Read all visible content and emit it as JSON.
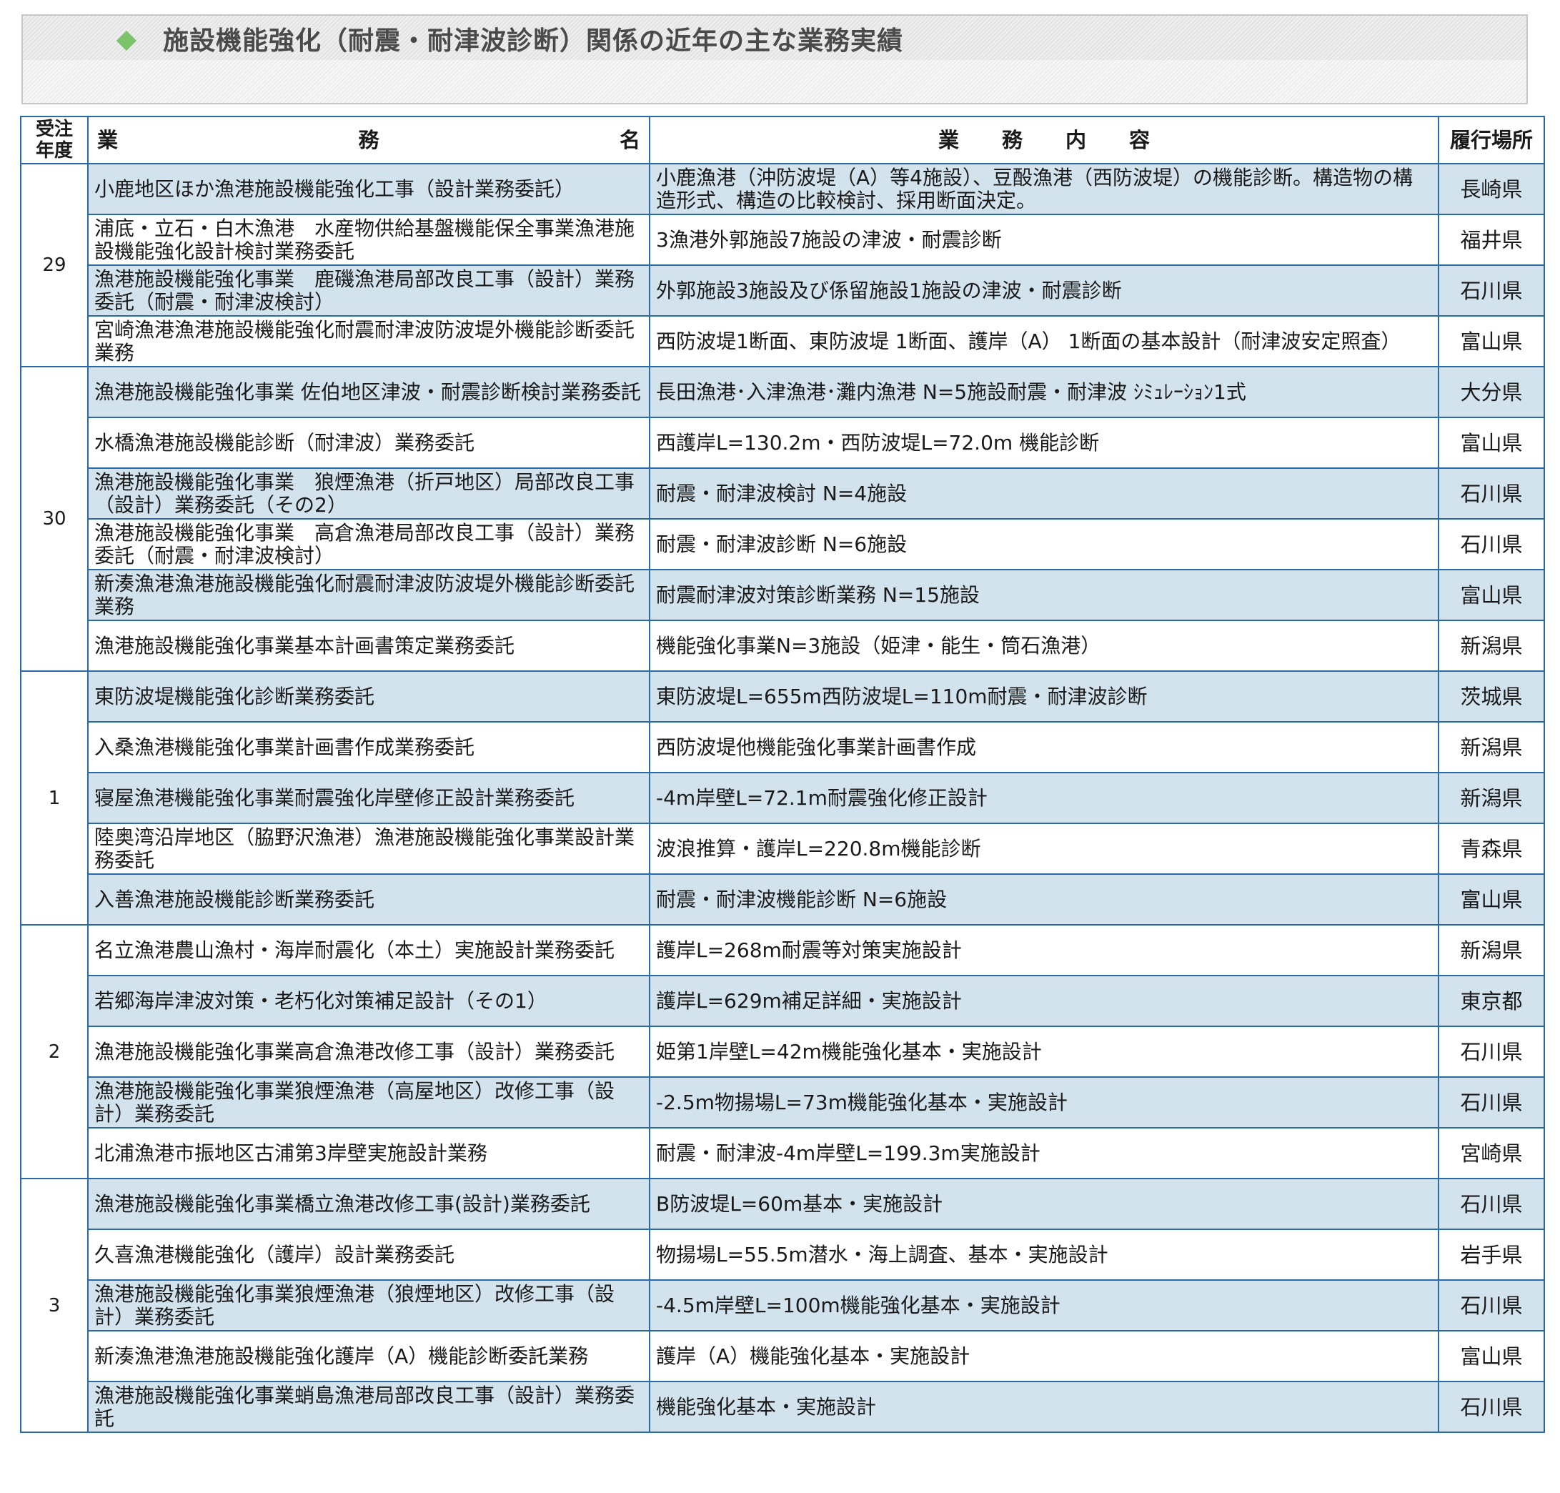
{
  "title": "施設機能強化（耐震・耐津波診断）関係の近年の主な業務実績",
  "colors": {
    "border": "#2b6aa8",
    "shaded_row": "#d3e3ee",
    "title_diamond": "#7cc36b",
    "title_text": "#4a4a4a"
  },
  "headers": {
    "year_line1": "受注",
    "year_line2": "年度",
    "name_chars": [
      "業",
      "務",
      "名"
    ],
    "content_chars": [
      "業",
      "務",
      "内",
      "容"
    ],
    "place": "履行場所"
  },
  "groups": [
    {
      "year": "29",
      "rows": [
        {
          "name": "小鹿地区ほか漁港施設機能強化工事（設計業務委託）",
          "content": "小鹿漁港（沖防波堤（A）等4施設）、豆酘漁港（西防波堤）の機能診断。構造物の構造形式、構造の比較検討、採用断面決定。",
          "place": "長崎県",
          "shaded": true
        },
        {
          "name": "浦底・立石・白木漁港　水産物供給基盤機能保全事業漁港施設機能強化設計検討業務委託",
          "content": "3漁港外郭施設7施設の津波・耐震診断",
          "place": "福井県",
          "shaded": false
        },
        {
          "name": "漁港施設機能強化事業　鹿磯漁港局部改良工事（設計）業務委託（耐震・耐津波検討）",
          "content": "外郭施設3施設及び係留施設1施設の津波・耐震診断",
          "place": "石川県",
          "shaded": true
        },
        {
          "name": "宮崎漁港漁港施設機能強化耐震耐津波防波堤外機能診断委託業務",
          "content": "西防波堤1断面、東防波堤 1断面、護岸（A） 1断面の基本設計（耐津波安定照査）",
          "place": "富山県",
          "shaded": false
        }
      ]
    },
    {
      "year": "30",
      "rows": [
        {
          "name": "漁港施設機能強化事業 佐伯地区津波・耐震診断検討業務委託",
          "content": "長田漁港･入津漁港･灘内漁港 N=5施設耐震・耐津波 ｼﾐｭﾚｰｼｮﾝ1式",
          "place": "大分県",
          "shaded": true
        },
        {
          "name": "水橋漁港施設機能診断（耐津波）業務委託",
          "content": "西護岸L=130.2m・西防波堤L=72.0m 機能診断",
          "place": "富山県",
          "shaded": false
        },
        {
          "name": "漁港施設機能強化事業　狼煙漁港（折戸地区）局部改良工事（設計）業務委託（その2）",
          "content": "耐震・耐津波検討 N=4施設",
          "place": "石川県",
          "shaded": true
        },
        {
          "name": "漁港施設機能強化事業　高倉漁港局部改良工事（設計）業務委託（耐震・耐津波検討）",
          "content": "耐震・耐津波診断 N=6施設",
          "place": "石川県",
          "shaded": false
        },
        {
          "name": "新湊漁港漁港施設機能強化耐震耐津波防波堤外機能診断委託業務",
          "content": "耐震耐津波対策診断業務 N=15施設",
          "place": "富山県",
          "shaded": true
        },
        {
          "name": "漁港施設機能強化事業基本計画書策定業務委託",
          "content": "機能強化事業N=3施設（姫津・能生・筒石漁港）",
          "place": "新潟県",
          "shaded": false
        }
      ]
    },
    {
      "year": "1",
      "rows": [
        {
          "name": "東防波堤機能強化診断業務委託",
          "content": "東防波堤L=655m西防波堤L=110m耐震・耐津波診断",
          "place": "茨城県",
          "shaded": true
        },
        {
          "name": "入桑漁港機能強化事業計画書作成業務委託",
          "content": "西防波堤他機能強化事業計画書作成",
          "place": "新潟県",
          "shaded": false
        },
        {
          "name": "寝屋漁港機能強化事業耐震強化岸壁修正設計業務委託",
          "content": "-4m岸壁L=72.1m耐震強化修正設計",
          "place": "新潟県",
          "shaded": true
        },
        {
          "name": "陸奥湾沿岸地区（脇野沢漁港）漁港施設機能強化事業設計業務委託",
          "content": "波浪推算・護岸L=220.8m機能診断",
          "place": "青森県",
          "shaded": false
        },
        {
          "name": "入善漁港施設機能診断業務委託",
          "content": "耐震・耐津波機能診断 N=6施設",
          "place": "富山県",
          "shaded": true
        }
      ]
    },
    {
      "year": "2",
      "rows": [
        {
          "name": "名立漁港農山漁村・海岸耐震化（本土）実施設計業務委託",
          "content": "護岸L=268m耐震等対策実施設計",
          "place": "新潟県",
          "shaded": false
        },
        {
          "name": "若郷海岸津波対策・老朽化対策補足設計（その1）",
          "content": "護岸L=629m補足詳細・実施設計",
          "place": "東京都",
          "shaded": true
        },
        {
          "name": "漁港施設機能強化事業高倉漁港改修工事（設計）業務委託",
          "content": "姫第1岸壁L=42m機能強化基本・実施設計",
          "place": "石川県",
          "shaded": false
        },
        {
          "name": "漁港施設機能強化事業狼煙漁港（高屋地区）改修工事（設計）業務委託",
          "content": "-2.5m物揚場L=73m機能強化基本・実施設計",
          "place": "石川県",
          "shaded": true
        },
        {
          "name": "北浦漁港市振地区古浦第3岸壁実施設計業務",
          "content": "耐震・耐津波-4m岸壁L=199.3m実施設計",
          "place": "宮崎県",
          "shaded": false
        }
      ]
    },
    {
      "year": "3",
      "rows": [
        {
          "name": "漁港施設機能強化事業橋立漁港改修工事(設計)業務委託",
          "content": "B防波堤L=60m基本・実施設計",
          "place": "石川県",
          "shaded": true
        },
        {
          "name": "久喜漁港機能強化（護岸）設計業務委託",
          "content": "物揚場L=55.5m潜水・海上調査、基本・実施設計",
          "place": "岩手県",
          "shaded": false
        },
        {
          "name": "漁港施設機能強化事業狼煙漁港（狼煙地区）改修工事（設計）業務委託",
          "content": "-4.5m岸壁L=100m機能強化基本・実施設計",
          "place": "石川県",
          "shaded": true
        },
        {
          "name": "新湊漁港漁港施設機能強化護岸（A）機能診断委託業務",
          "content": "護岸（A）機能強化基本・実施設計",
          "place": "富山県",
          "shaded": false
        },
        {
          "name": "漁港施設機能強化事業蛸島漁港局部改良工事（設計）業務委託",
          "content": "機能強化基本・実施設計",
          "place": "石川県",
          "shaded": true
        }
      ]
    }
  ]
}
